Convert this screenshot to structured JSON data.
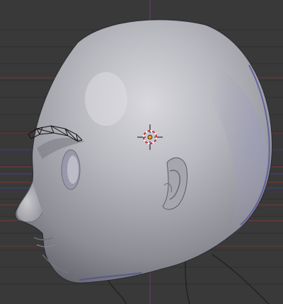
{
  "colors": {
    "background": "#393939",
    "grid_line": "#2f2f2f",
    "axis_x": "#8a3a3a",
    "axis_y": "#3a3a8a",
    "axis_z": "#6a3a7a",
    "mesh_shade": "#a8a8b0",
    "wire": "#111111",
    "cursor_ring": "#c82828"
  },
  "viewport": {
    "object": "head-mesh",
    "selection": "eyebrow-wireframe",
    "cursor": "3d-cursor"
  }
}
